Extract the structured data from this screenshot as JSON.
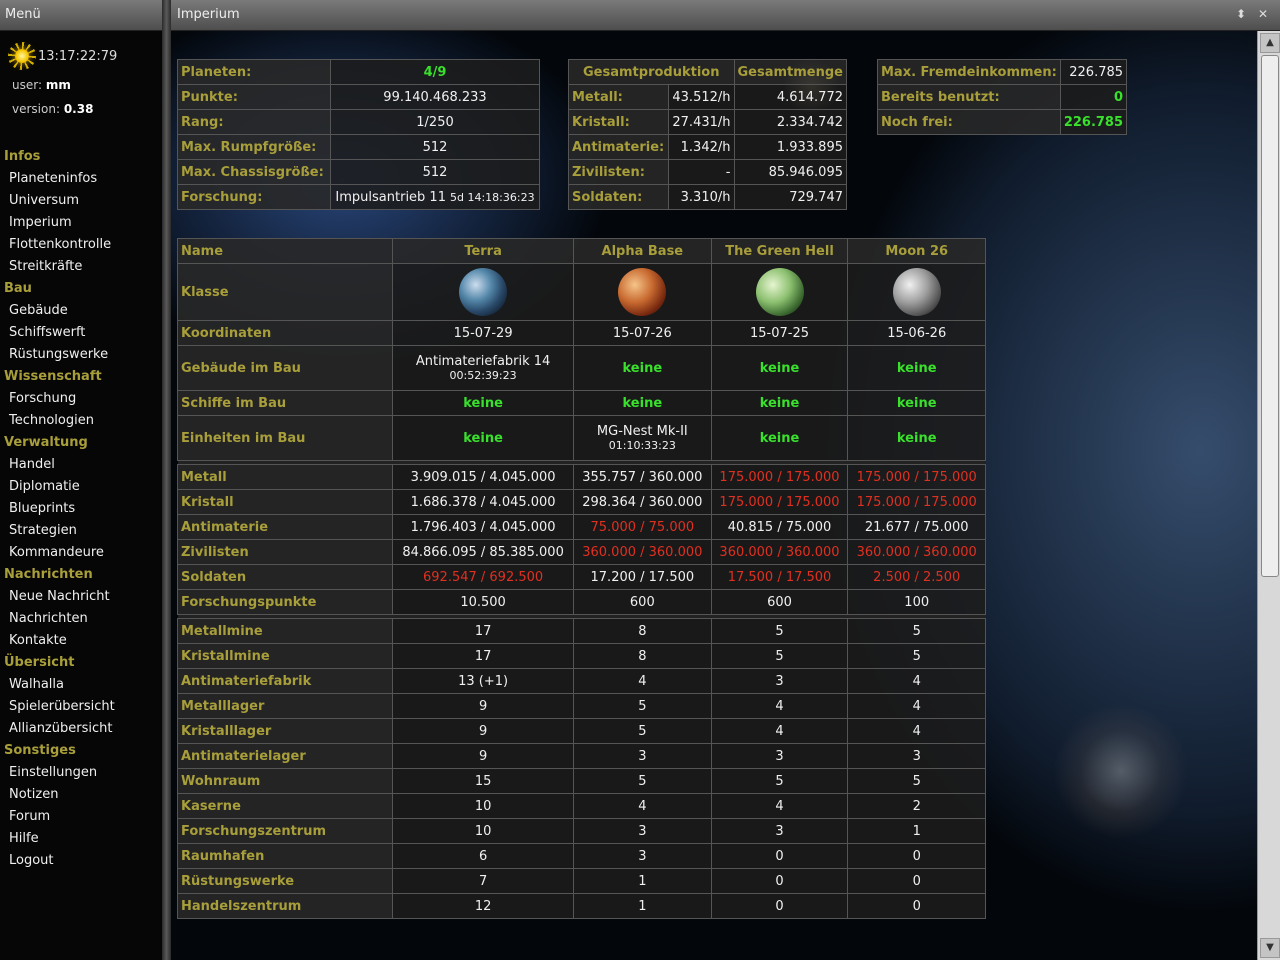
{
  "menu": {
    "title": "Menü",
    "clock": "13:17:22:79",
    "user_label": "user:",
    "user_value": "mm",
    "version_label": "version:",
    "version_value": "0.38",
    "sections": [
      {
        "title": "Infos",
        "items": [
          "Planeteninfos",
          "Universum",
          "Imperium",
          "Flottenkontrolle",
          "Streitkräfte"
        ]
      },
      {
        "title": "Bau",
        "items": [
          "Gebäude",
          "Schiffswerft",
          "Rüstungswerke"
        ]
      },
      {
        "title": "Wissenschaft",
        "items": [
          "Forschung",
          "Technologien"
        ]
      },
      {
        "title": "Verwaltung",
        "items": [
          "Handel",
          "Diplomatie",
          "Blueprints",
          "Strategien",
          "Kommandeure"
        ]
      },
      {
        "title": "Nachrichten",
        "items": [
          "Neue Nachricht",
          "Nachrichten",
          "Kontakte"
        ]
      },
      {
        "title": "Übersicht",
        "items": [
          "Walhalla",
          "Spielerübersicht",
          "Allianzübersicht"
        ]
      },
      {
        "title": "Sonstiges",
        "items": [
          "Einstellungen",
          "Notizen",
          "Forum",
          "Hilfe",
          "Logout"
        ]
      }
    ]
  },
  "window": {
    "title": "Imperium",
    "resize_glyph": "⬍",
    "close_glyph": "✕",
    "scroll_up_glyph": "▲",
    "scroll_down_glyph": "▼"
  },
  "stats": [
    {
      "label": "Planeten:",
      "value": "4/9",
      "green": true
    },
    {
      "label": "Punkte:",
      "value": "99.140.468.233"
    },
    {
      "label": "Rang:",
      "value": "1/250"
    },
    {
      "label": "Max. Rumpfgröße:",
      "value": "512"
    },
    {
      "label": "Max. Chassisgröße:",
      "value": "512"
    },
    {
      "label": "Forschung:",
      "value": "Impulsantrieb 11",
      "sub": "5d 14:18:36:23"
    }
  ],
  "production": {
    "headers": [
      "Gesamtproduktion",
      "Gesamtmenge"
    ],
    "rows": [
      {
        "label": "Metall:",
        "rate": "43.512/h",
        "total": "4.614.772"
      },
      {
        "label": "Kristall:",
        "rate": "27.431/h",
        "total": "2.334.742"
      },
      {
        "label": "Antimaterie:",
        "rate": "1.342/h",
        "total": "1.933.895"
      },
      {
        "label": "Zivilisten:",
        "rate": "-",
        "total": "85.946.095"
      },
      {
        "label": "Soldaten:",
        "rate": "3.310/h",
        "total": "729.747"
      }
    ]
  },
  "income": [
    {
      "label": "Max. Fremdeinkommen:",
      "value": "226.785"
    },
    {
      "label": "Bereits benutzt:",
      "value": "0",
      "green": true
    },
    {
      "label": "Noch frei:",
      "value": "226.785",
      "green": true
    }
  ],
  "planets": {
    "name_label": "Name",
    "names": [
      "Terra",
      "Alpha Base",
      "The Green Hell",
      "Moon 26"
    ],
    "class_label": "Klasse",
    "coords_label": "Koordinaten",
    "coords": [
      "15-07-29",
      "15-07-26",
      "15-07-25",
      "15-06-26"
    ],
    "build_rows": [
      {
        "label": "Gebäude im Bau",
        "cells": [
          {
            "text": "Antimateriefabrik 14",
            "sub": "00:52:39:23"
          },
          {
            "text": "keine",
            "green": true
          },
          {
            "text": "keine",
            "green": true
          },
          {
            "text": "keine",
            "green": true
          }
        ]
      },
      {
        "label": "Schiffe im Bau",
        "cells": [
          {
            "text": "keine",
            "green": true
          },
          {
            "text": "keine",
            "green": true
          },
          {
            "text": "keine",
            "green": true
          },
          {
            "text": "keine",
            "green": true
          }
        ]
      },
      {
        "label": "Einheiten im Bau",
        "cells": [
          {
            "text": "keine",
            "green": true
          },
          {
            "text": "MG-Nest Mk-II",
            "sub": "01:10:33:23"
          },
          {
            "text": "keine",
            "green": true
          },
          {
            "text": "keine",
            "green": true
          }
        ]
      }
    ],
    "resource_rows": [
      {
        "label": "Metall",
        "cells": [
          {
            "text": "3.909.015 / 4.045.000"
          },
          {
            "text": "355.757 / 360.000"
          },
          {
            "text": "175.000 / 175.000",
            "red": true
          },
          {
            "text": "175.000 / 175.000",
            "red": true
          }
        ]
      },
      {
        "label": "Kristall",
        "cells": [
          {
            "text": "1.686.378 / 4.045.000"
          },
          {
            "text": "298.364 / 360.000"
          },
          {
            "text": "175.000 / 175.000",
            "red": true
          },
          {
            "text": "175.000 / 175.000",
            "red": true
          }
        ]
      },
      {
        "label": "Antimaterie",
        "cells": [
          {
            "text": "1.796.403 / 4.045.000"
          },
          {
            "text": "75.000 / 75.000",
            "red": true
          },
          {
            "text": "40.815 / 75.000"
          },
          {
            "text": "21.677 / 75.000"
          }
        ]
      },
      {
        "label": "Zivilisten",
        "cells": [
          {
            "text": "84.866.095 / 85.385.000"
          },
          {
            "text": "360.000 / 360.000",
            "red": true
          },
          {
            "text": "360.000 / 360.000",
            "red": true
          },
          {
            "text": "360.000 / 360.000",
            "red": true
          }
        ]
      },
      {
        "label": "Soldaten",
        "cells": [
          {
            "text": "692.547 / 692.500",
            "red": true
          },
          {
            "text": "17.200 / 17.500"
          },
          {
            "text": "17.500 / 17.500",
            "red": true
          },
          {
            "text": "2.500 / 2.500",
            "red": true
          }
        ]
      },
      {
        "label": "Forschungspunkte",
        "cells": [
          {
            "text": "10.500"
          },
          {
            "text": "600"
          },
          {
            "text": "600"
          },
          {
            "text": "100"
          }
        ]
      }
    ],
    "building_rows": [
      {
        "label": "Metallmine",
        "values": [
          "17",
          "8",
          "5",
          "5"
        ]
      },
      {
        "label": "Kristallmine",
        "values": [
          "17",
          "8",
          "5",
          "5"
        ]
      },
      {
        "label": "Antimateriefabrik",
        "values": [
          "13 (+1)",
          "4",
          "3",
          "4"
        ]
      },
      {
        "label": "Metalllager",
        "values": [
          "9",
          "5",
          "4",
          "4"
        ]
      },
      {
        "label": "Kristalllager",
        "values": [
          "9",
          "5",
          "4",
          "4"
        ]
      },
      {
        "label": "Antimaterielager",
        "values": [
          "9",
          "3",
          "3",
          "3"
        ]
      },
      {
        "label": "Wohnraum",
        "values": [
          "15",
          "5",
          "5",
          "5"
        ]
      },
      {
        "label": "Kaserne",
        "values": [
          "10",
          "4",
          "4",
          "2"
        ]
      },
      {
        "label": "Forschungszentrum",
        "values": [
          "10",
          "3",
          "3",
          "1"
        ]
      },
      {
        "label": "Raumhafen",
        "values": [
          "6",
          "3",
          "0",
          "0"
        ]
      },
      {
        "label": "Rüstungswerke",
        "values": [
          "7",
          "1",
          "0",
          "0"
        ]
      },
      {
        "label": "Handelszentrum",
        "values": [
          "12",
          "1",
          "0",
          "0"
        ]
      }
    ]
  }
}
